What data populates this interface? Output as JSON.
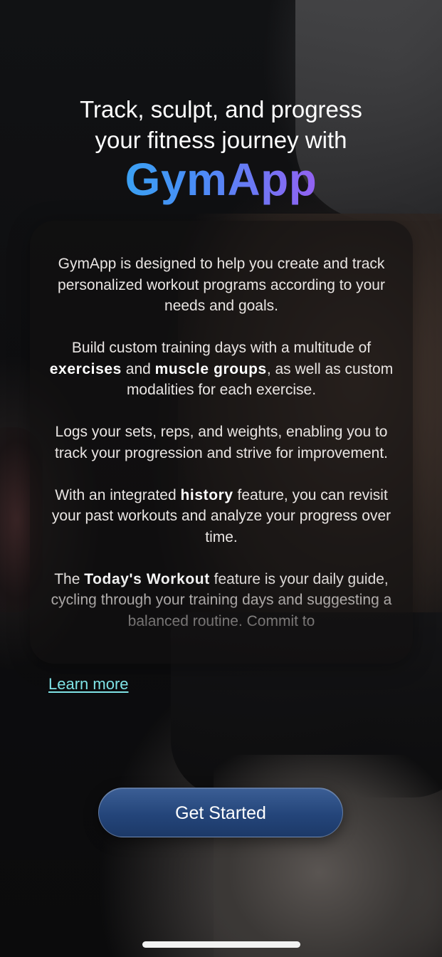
{
  "headline": {
    "line1": "Track, sculpt, and progress",
    "line2": "your fitness journey with",
    "brand": "GymApp"
  },
  "info": {
    "p1": "GymApp is designed to help you create and track personalized workout programs according to your needs and goals.",
    "p2": {
      "before": "Build custom training days with a multitude of ",
      "bold1": "exercises",
      "middle": " and ",
      "bold2": "muscle groups",
      "after": ", as well as custom modalities for each exercise."
    },
    "p3": "Logs your sets, reps, and weights, enabling you to track your progression and strive for improvement.",
    "p4": {
      "before": "With an integrated ",
      "bold": "history",
      "after": " feature, you can revisit your past workouts and analyze your progress over time."
    },
    "p5": {
      "before": "The ",
      "bold": "Today's Workout",
      "after": " feature is your daily guide, cycling through your training days and suggesting a balanced routine. Commit to"
    }
  },
  "learn_more": "Learn more",
  "cta": {
    "label": "Get Started"
  },
  "colors": {
    "brand_gradient_start": "#22c4ee",
    "brand_gradient_end": "#b34ee6",
    "link": "#7fe3e6",
    "button": "#24457a"
  }
}
